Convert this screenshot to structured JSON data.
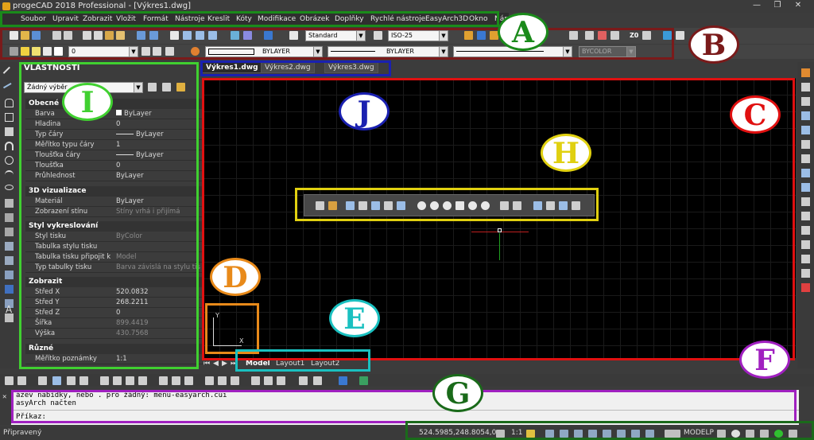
{
  "window": {
    "title": "progeCAD 2018 Professional - [Výkres1.dwg]",
    "min_glyph": "—",
    "max_glyph": "❐",
    "close_glyph": "✕"
  },
  "menubar": {
    "items": [
      "Soubor",
      "Upravit",
      "Zobrazit",
      "Vložit",
      "Formát",
      "Nástroje",
      "Kreslit",
      "Kóty",
      "Modifikace",
      "Obrázek",
      "Doplňky",
      "Rychlé nástroje",
      "EasyArch3D",
      "Okno",
      "Náp"
    ]
  },
  "toolbar": {
    "text_style": "Standard",
    "dim_style": "ISO-25",
    "layer": "0",
    "color": "BYLAYER",
    "linetype": "BYLAYER",
    "lineweight": "",
    "plot_style": "BYCOLOR",
    "zoom_label": "Z0"
  },
  "properties": {
    "header": "VLASTNOSTI",
    "selection": "Žádný výběr",
    "sections": [
      {
        "title": "Obecné",
        "rows": [
          {
            "k": "Barva",
            "v": "ByLayer"
          },
          {
            "k": "Hladina",
            "v": "0"
          },
          {
            "k": "Typ čáry",
            "v": "ByLayer"
          },
          {
            "k": "Měřítko typu čáry",
            "v": "1"
          },
          {
            "k": "Tloušťka čáry",
            "v": "ByLayer"
          },
          {
            "k": "Tloušťka",
            "v": "0"
          },
          {
            "k": "Průhlednost",
            "v": "ByLayer"
          }
        ]
      },
      {
        "title": "3D vizualizace",
        "rows": [
          {
            "k": "Materiál",
            "v": "ByLayer"
          },
          {
            "k": "Zobrazení stínu",
            "v": "Stíny vrhá i přijímá",
            "dim": true
          }
        ]
      },
      {
        "title": "Styl vykreslování",
        "rows": [
          {
            "k": "Styl tisku",
            "v": "ByColor",
            "dim": true
          },
          {
            "k": "Tabulka stylu tisku",
            "v": ""
          },
          {
            "k": "Tabulka tisku připojit k",
            "v": "Model",
            "dim": true
          },
          {
            "k": "Typ tabulky tisku",
            "v": "Barva závislá na stylu tis",
            "dim": true
          }
        ]
      },
      {
        "title": "Zobrazit",
        "rows": [
          {
            "k": "Střed X",
            "v": "520.0832"
          },
          {
            "k": "Střed Y",
            "v": "268.2211"
          },
          {
            "k": "Střed Z",
            "v": "0"
          },
          {
            "k": "Šířka",
            "v": "899.4419",
            "dim": true
          },
          {
            "k": "Výška",
            "v": "430.7568",
            "dim": true
          }
        ]
      },
      {
        "title": "Různé",
        "rows": [
          {
            "k": "Měřítko poznámky",
            "v": "1:1"
          }
        ]
      }
    ]
  },
  "doc_tabs": [
    "Výkres1.dwg",
    "Výkres2.dwg",
    "Výkres3.dwg"
  ],
  "doc_tab_close": "✕",
  "layout_tabs": [
    "Model",
    "Layout1",
    "Layout2"
  ],
  "ucs": {
    "x": "X",
    "y": "Y"
  },
  "command": {
    "line1": "ázev nabídky, nebo . pro žádný: menu-easyarch.cui",
    "line2": "asyArch načten",
    "prompt": "Příkaz:"
  },
  "status": {
    "ready": "Připravený",
    "coords": "524.5985,248.8054,0",
    "scale": "1:1",
    "modelp": "MODELP"
  },
  "annotations": [
    {
      "letter": "A",
      "color": "#1a8a1a"
    },
    {
      "letter": "B",
      "color": "#7a1a1a"
    },
    {
      "letter": "C",
      "color": "#e01010"
    },
    {
      "letter": "D",
      "color": "#e88a1a"
    },
    {
      "letter": "E",
      "color": "#1ac0c0"
    },
    {
      "letter": "F",
      "color": "#a020c0"
    },
    {
      "letter": "G",
      "color": "#1a6a1a"
    },
    {
      "letter": "H",
      "color": "#e0d010"
    },
    {
      "letter": "I",
      "color": "#40d030"
    },
    {
      "letter": "J",
      "color": "#1a20b0"
    }
  ]
}
